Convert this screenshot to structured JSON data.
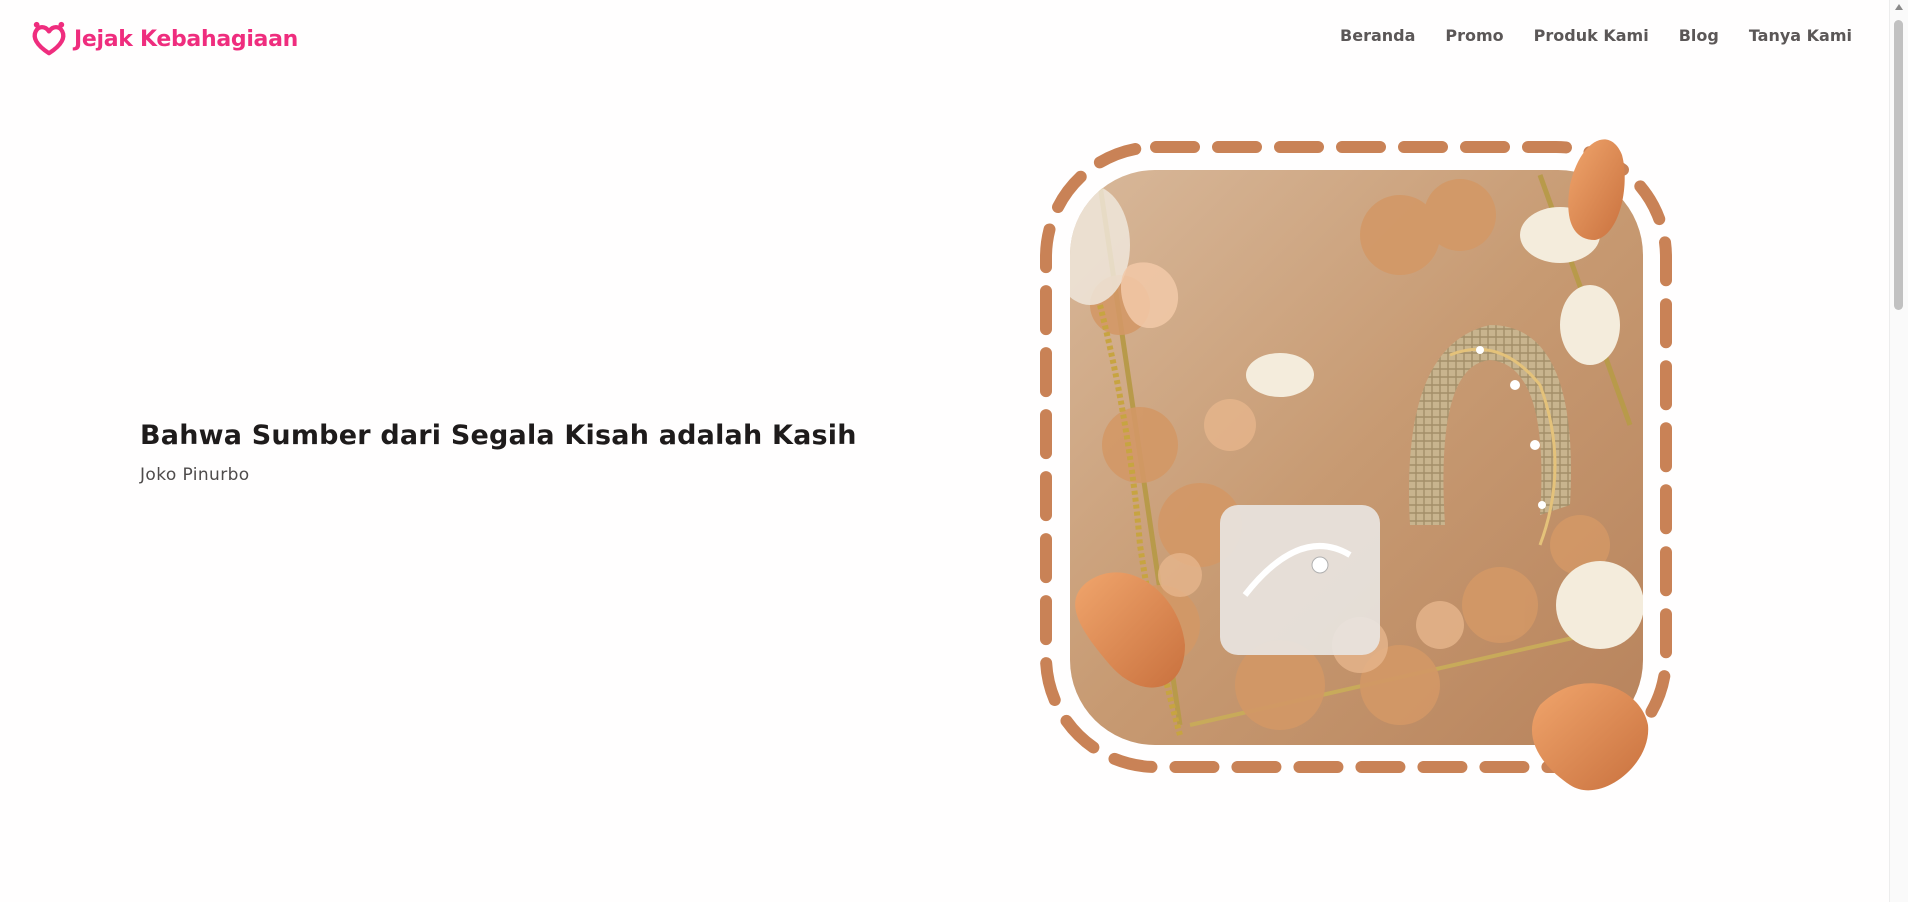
{
  "brand": {
    "name": "Jejak Kebahagiaan",
    "color": "#ef2d7e",
    "icon": "heart-logo-icon"
  },
  "nav": {
    "items": [
      {
        "label": "Beranda"
      },
      {
        "label": "Promo"
      },
      {
        "label": "Produk Kami"
      },
      {
        "label": "Blog"
      },
      {
        "label": "Tanya Kami"
      }
    ]
  },
  "hero": {
    "quote": "Bahwa Sumber dari Segala Kisah adalah Kasih",
    "author": "Joko Pinurbo",
    "image": "ring-and-bracelet-gift-box-with-dried-flowers",
    "frame_color": "#c98256"
  }
}
